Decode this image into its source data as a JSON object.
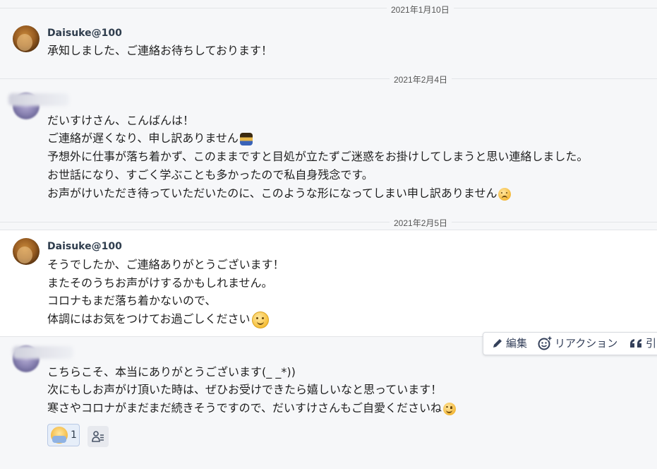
{
  "dates": [
    "2021年1月10日",
    "2021年2月4日",
    "2021年2月5日"
  ],
  "messages": [
    {
      "author": "Daisuke@100",
      "lines": [
        "承知しました、ご連絡お待ちしております！"
      ]
    },
    {
      "author": "",
      "lines": [
        "だいすけさん、こんばんは！",
        "ご連絡が遅くなり、申し訳ありません",
        "予想外に仕事が落ち着かず、このままですと目処が立たずご迷惑をお掛けしてしまうと思い連絡しました。",
        "お世話になり、すごく学ぶことも多かったので私自身残念です。",
        "お声がけいただき待っていただいたのに、このような形になってしまい申し訳ありません"
      ]
    },
    {
      "author": "Daisuke@100",
      "lines": [
        "そうでしたか、ご連絡ありがとうございます！",
        "またそのうちお声がけするかもしれません。",
        "コロナもまだ落ち着かないので、",
        "体調にはお気をつけてお過ごしください"
      ]
    },
    {
      "author": "",
      "lines": [
        "こちらこそ、本当にありがとうございます(_ _*))",
        "次にもしお声がけ頂いた時は、ぜひお受けできたら嬉しいなと思っています！",
        "寒さやコロナがまだまだ続きそうですので、だいすけさんもご自愛くださいね"
      ]
    }
  ],
  "toolbar": {
    "edit_label": "編集",
    "reaction_label": "リアクション",
    "quote_label": "引"
  },
  "reaction": {
    "emoji": "bowing-emoji",
    "count": "1"
  },
  "icons": {
    "edit": "pencil-icon",
    "reaction": "smiley-add-icon",
    "quote": "quote-icon",
    "readers": "person-list-icon"
  }
}
